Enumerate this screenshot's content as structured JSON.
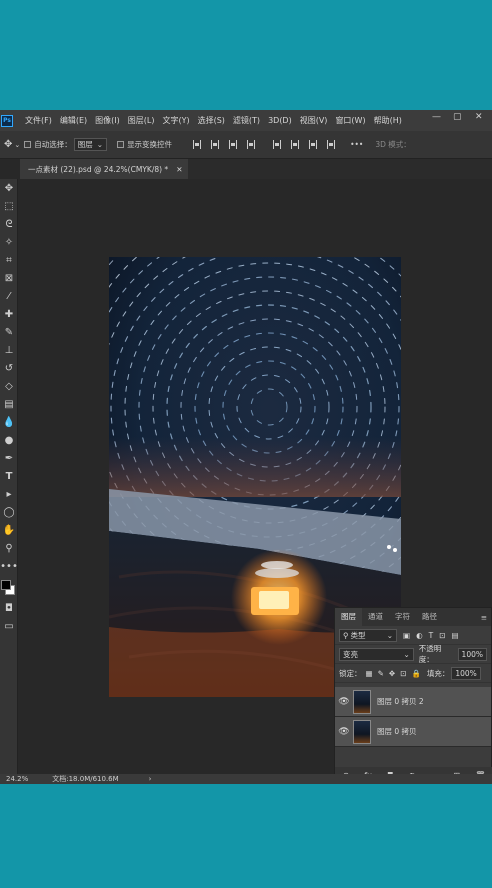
{
  "menubar": {
    "logo": "Ps",
    "items": [
      "文件(F)",
      "编辑(E)",
      "图像(I)",
      "图层(L)",
      "文字(Y)",
      "选择(S)",
      "滤镜(T)",
      "3D(D)",
      "视图(V)",
      "窗口(W)",
      "帮助(H)"
    ]
  },
  "options": {
    "auto_select_label": "自动选择：",
    "auto_select_value": "图层",
    "transform_label": "显示变换控件",
    "mode_label": "3D 模式："
  },
  "document": {
    "tab_title": "一点素材 (22).psd @ 24.2%(CMYK/8) *"
  },
  "status": {
    "zoom": "24.2%",
    "doc_size": "文档:18.0M/610.6M"
  },
  "layers_panel": {
    "tabs": [
      "图层",
      "通道",
      "字符",
      "路径"
    ],
    "filter_label": "类型",
    "blend_mode": "变亮",
    "opacity_label": "不透明度：",
    "opacity_value": "100%",
    "lock_label": "锁定：",
    "fill_label": "填充：",
    "fill_value": "100%",
    "layers": [
      {
        "name": "图层 0 拷贝 2"
      },
      {
        "name": "图层 0 拷贝"
      }
    ]
  }
}
